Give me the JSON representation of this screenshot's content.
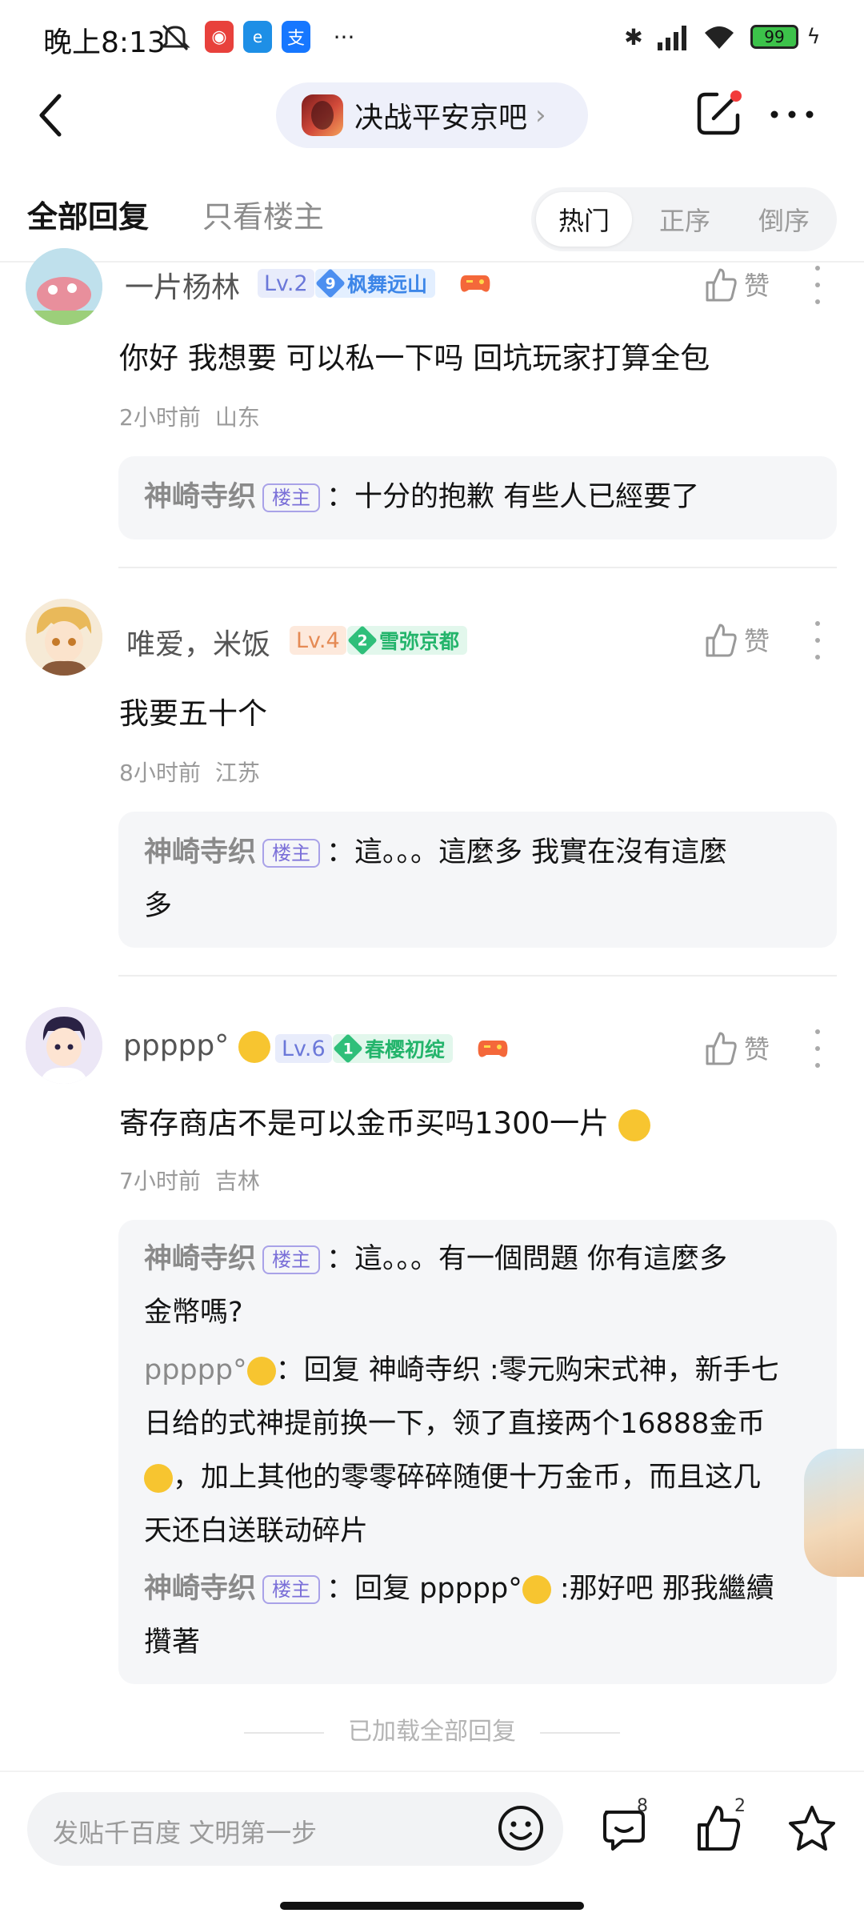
{
  "status_bar": {
    "time": "晚上8:13",
    "battery": "99"
  },
  "header": {
    "forum_name": "决战平安京吧"
  },
  "tabs": {
    "all_replies": "全部回复",
    "op_only": "只看楼主"
  },
  "sort": {
    "hot": "热门",
    "asc": "正序",
    "desc": "倒序",
    "selected": "热门"
  },
  "like_label": "赞",
  "op_tag": "楼主",
  "comments": [
    {
      "user": "一片杨林",
      "level": "Lv.2",
      "badge_num": "9",
      "badge_name": "枫舞远山",
      "text": "你好 我想要 可以私一下吗 回坑玩家打算全包",
      "time": "2小时前",
      "location": "山东",
      "replies": [
        {
          "name": "神崎寺织",
          "is_op": true,
          "text": "十分的抱歉 有些人已經要了"
        }
      ]
    },
    {
      "user": "唯爱，米饭",
      "level": "Lv.4",
      "badge_num": "2",
      "badge_name": "雪弥京都",
      "text": "我要五十个",
      "time": "8小时前",
      "location": "江苏",
      "replies": [
        {
          "name": "神崎寺织",
          "is_op": true,
          "text_l1": "這。。。這麼多 我實在沒有這麼",
          "text_l2": "多"
        }
      ]
    },
    {
      "user": "ppppp°",
      "level": "Lv.6",
      "badge_num": "1",
      "badge_name": "春樱初绽",
      "text": "寄存商店不是可以金币买吗1300一片",
      "time": "7小时前",
      "location": "吉林",
      "replies": [
        {
          "name": "神崎寺织",
          "is_op": true,
          "text_l1": "這。。。有一個問題 你有這麼多",
          "text_l2": "金幣嗎?"
        },
        {
          "name": "ppppp°",
          "is_op": false,
          "text_l1": "回复 神崎寺织 :零元购宋式神，新手七",
          "text_l2": "日给的式神提前换一下，领了直接两个16888金币",
          "text_l3": "，加上其他的零零碎碎随便十万金币，而且这几",
          "text_l4": "天还白送联动碎片"
        },
        {
          "name": "神崎寺织",
          "is_op": true,
          "text_l1a": "回复 ppppp°",
          "text_l1b": ":那好吧 那我繼續",
          "text_l2": "攢著"
        }
      ]
    }
  ],
  "all_loaded": "已加载全部回复",
  "bottom": {
    "placeholder": "发贴千百度 文明第一步",
    "comment_count": "8",
    "like_count": "2"
  },
  "colors": {
    "lv_blue_bg": "#e8ecfb",
    "lv_orange_bg": "#fde9dc",
    "badge_blue": "#4c8ff0",
    "badge_green": "#2fbf7a",
    "op_purple": "#7a6fd8"
  }
}
